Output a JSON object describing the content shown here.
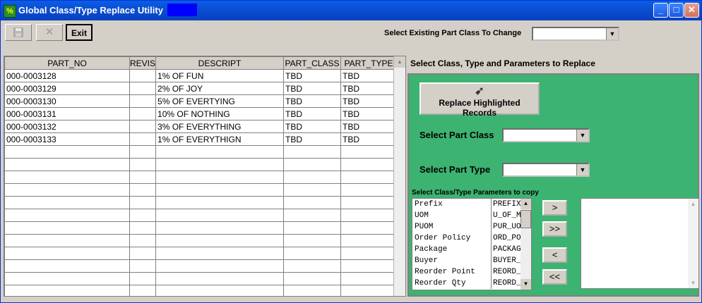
{
  "window": {
    "title": "Global Class/Type Replace Utility",
    "minimize": "_",
    "maximize": "□",
    "close": "✕"
  },
  "toolbar": {
    "save_icon": "floppy-disk-icon",
    "cancel_glyph": "✕",
    "exit_label": "Exit"
  },
  "existing": {
    "label": "Select Existing Part Class To Change",
    "value": ""
  },
  "grid": {
    "columns": [
      "PART_NO",
      "REVIS",
      "DESCRIPT",
      "PART_CLASS",
      "PART_TYPE"
    ],
    "rows": [
      [
        "000-0003128",
        "",
        "1% OF FUN",
        "TBD",
        "TBD"
      ],
      [
        "000-0003129",
        "",
        "2% OF JOY",
        "TBD",
        "TBD"
      ],
      [
        "000-0003130",
        "",
        "5% OF EVERTYING",
        "TBD",
        "TBD"
      ],
      [
        "000-0003131",
        "",
        "10% OF NOTHING",
        "TBD",
        "TBD"
      ],
      [
        "000-0003132",
        "",
        "3% OF EVERYTHING",
        "TBD",
        "TBD"
      ],
      [
        "000-0003133",
        "",
        "1% OF EVERYTHIGN",
        "TBD",
        "TBD"
      ]
    ]
  },
  "panel": {
    "title": "Select Class, Type and Parameters to Replace",
    "replace_button": "Replace Highlighted Records",
    "part_class_label": "Select Part Class",
    "part_type_label": "Select Part Type",
    "params_label": "Select Class/Type Parameters to copy",
    "params": [
      {
        "name": "Prefix",
        "field": "PREFIX"
      },
      {
        "name": "UOM",
        "field": "U_OF_M"
      },
      {
        "name": "PUOM",
        "field": "PUR_UOM"
      },
      {
        "name": "Order Policy",
        "field": "ORD_POL"
      },
      {
        "name": "Package",
        "field": "PACKAGE"
      },
      {
        "name": "Buyer",
        "field": "BUYER_"
      },
      {
        "name": "Reorder Point",
        "field": "REORD_"
      },
      {
        "name": "Reorder Qty",
        "field": "REORD_"
      }
    ],
    "move_buttons": {
      "add": ">",
      "add_all": ">>",
      "remove": "<",
      "remove_all": "<<"
    }
  }
}
